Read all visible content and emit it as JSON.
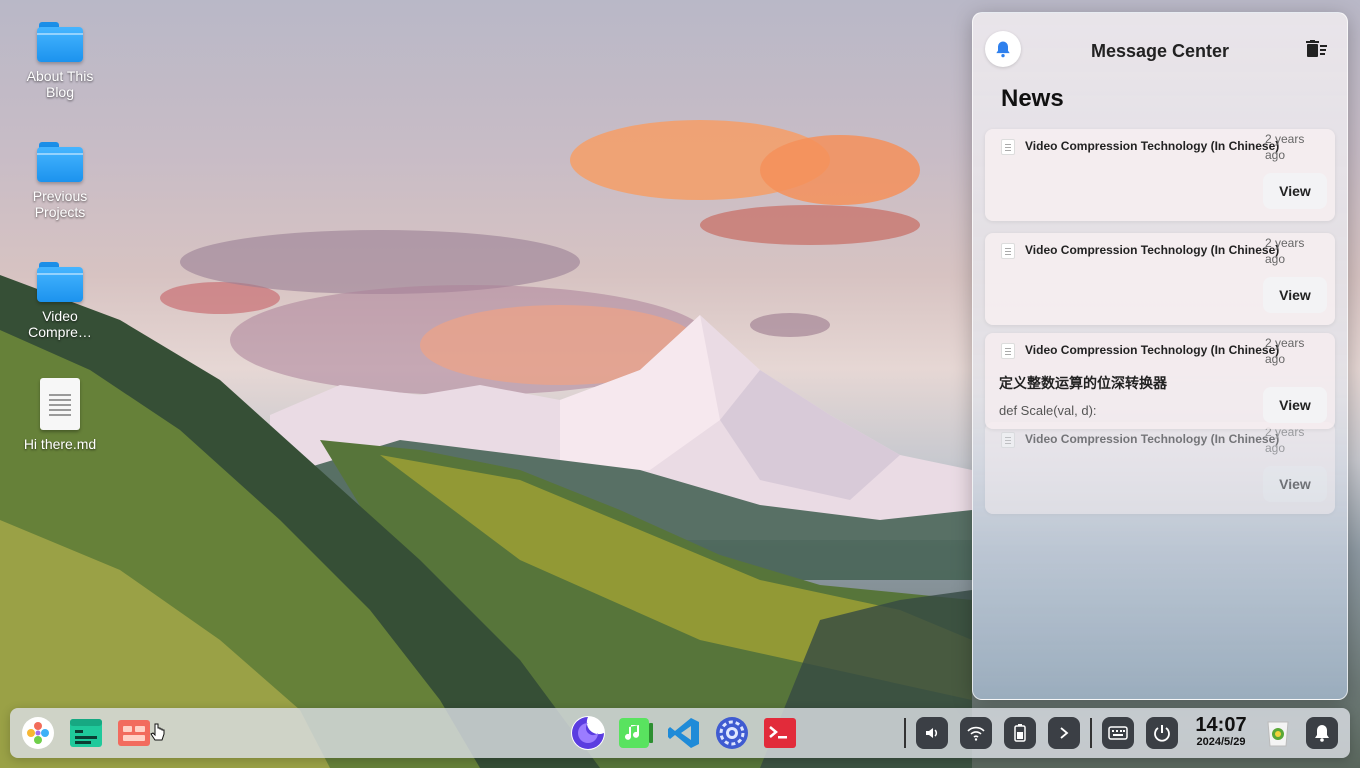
{
  "desktop": {
    "icons": [
      {
        "label": "About This Blog",
        "type": "folder"
      },
      {
        "label": "Previous Projects",
        "type": "folder"
      },
      {
        "label": "Video Compre…",
        "type": "folder"
      },
      {
        "label": "Hi there.md",
        "type": "document"
      }
    ]
  },
  "message_center": {
    "title": "Message Center",
    "section": "News",
    "notifications": [
      {
        "headline": "Video Compression Technology (In Chinese)",
        "time": "2 years ago",
        "action": "View"
      },
      {
        "headline": "Video Compression Technology (In Chinese)",
        "time": "2 years ago",
        "action": "View"
      },
      {
        "headline": "Video Compression Technology (In Chinese)",
        "time": "2 years ago",
        "action": "View",
        "body_title": "定义整数运算的位深转换器",
        "body_text": "def Scale(val, d):"
      },
      {
        "headline": "Video Compression Technology (In Chinese)",
        "time": "2 years ago",
        "action": "View"
      }
    ]
  },
  "taskbar": {
    "left_apps": [
      "launcher-icon",
      "terminal-app-icon",
      "multitask-view-icon"
    ],
    "pinned_apps": [
      "browser-icon",
      "music-icon",
      "vscode-icon",
      "settings-icon",
      "terminal-icon"
    ],
    "tray": [
      "volume-icon",
      "wifi-icon",
      "battery-icon",
      "expand-icon",
      "keyboard-icon",
      "power-icon"
    ],
    "clock": {
      "time": "14:07",
      "date": "2024/5/29"
    }
  },
  "colors": {
    "folder_blue": "#1c93ee",
    "tray_button": "#3b3f45",
    "notification_bell": "#2f80ed"
  }
}
